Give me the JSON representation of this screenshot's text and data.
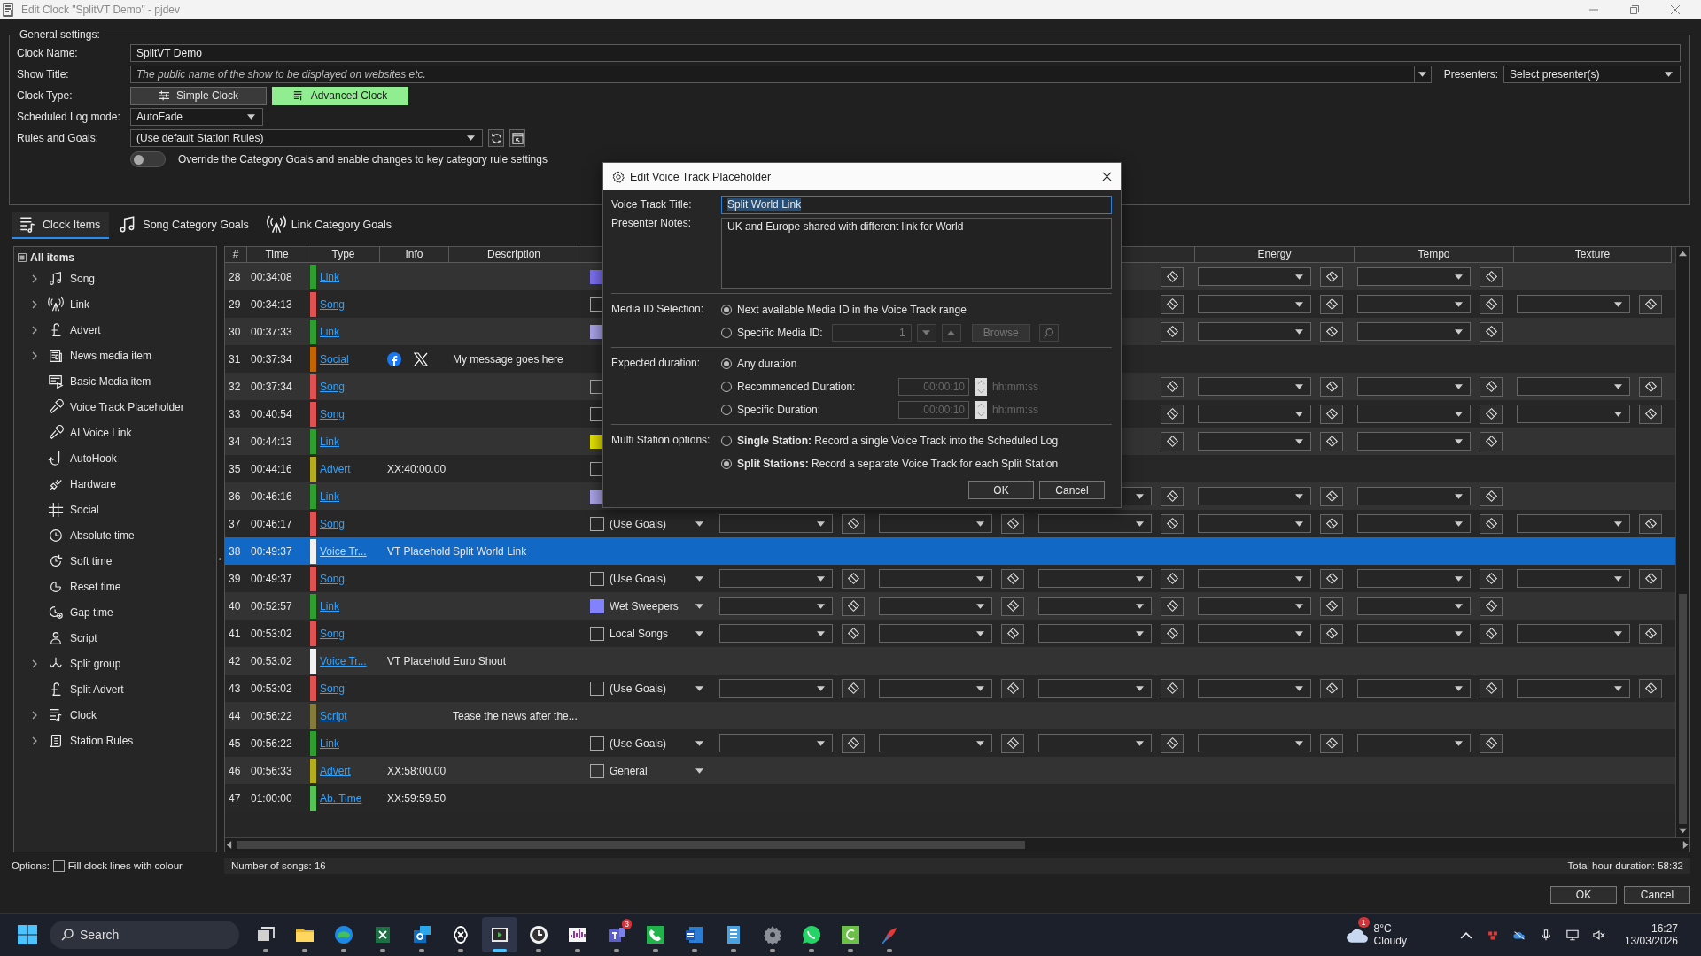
{
  "window": {
    "title": "Edit Clock \"SplitVT Demo\" - pjdev"
  },
  "general": {
    "legend": "General settings:",
    "clock_name": {
      "label": "Clock Name:",
      "value": "SplitVT Demo"
    },
    "show_title": {
      "label": "Show Title:",
      "placeholder": "The public name of the show to be displayed on websites etc."
    },
    "presenters": {
      "label": "Presenters:",
      "value": "Select presenter(s)"
    },
    "clock_type": {
      "label": "Clock Type:",
      "options": [
        {
          "label": "Simple Clock",
          "selected": false
        },
        {
          "label": "Advanced Clock",
          "selected": true
        }
      ]
    },
    "log_mode": {
      "label": "Scheduled Log mode:",
      "value": "AutoFade"
    },
    "rules": {
      "label": "Rules and Goals:",
      "value": "(Use default Station Rules)"
    },
    "override": {
      "label": "Override the Category Goals and enable changes to key category rule settings",
      "on": false
    }
  },
  "tabs": [
    {
      "label": "Clock Items",
      "selected": true
    },
    {
      "label": "Song Category Goals",
      "selected": false
    },
    {
      "label": "Link Category Goals",
      "selected": false
    }
  ],
  "sidebar": {
    "root": {
      "label": "All items"
    },
    "items": [
      {
        "label": "Song",
        "expandable": true
      },
      {
        "label": "Link",
        "expandable": true
      },
      {
        "label": "Advert",
        "expandable": true
      },
      {
        "label": "News media item",
        "expandable": true
      },
      {
        "label": "Basic Media item",
        "expandable": false
      },
      {
        "label": "Voice Track Placeholder",
        "expandable": false
      },
      {
        "label": "AI Voice Link",
        "expandable": false
      },
      {
        "label": "AutoHook",
        "expandable": false
      },
      {
        "label": "Hardware",
        "expandable": false
      },
      {
        "label": "Social",
        "expandable": false
      },
      {
        "label": "Absolute time",
        "expandable": false
      },
      {
        "label": "Soft time",
        "expandable": false
      },
      {
        "label": "Reset time",
        "expandable": false
      },
      {
        "label": "Gap time",
        "expandable": false
      },
      {
        "label": "Script",
        "expandable": false
      },
      {
        "label": "Split group",
        "expandable": true
      },
      {
        "label": "Split Advert",
        "expandable": false
      },
      {
        "label": "Clock",
        "expandable": true
      },
      {
        "label": "Station Rules",
        "expandable": true
      }
    ]
  },
  "table": {
    "columns": [
      "#",
      "Time",
      "Type",
      "Info",
      "Description"
    ],
    "goal_columns": [
      "Energy",
      "Tempo",
      "Texture"
    ],
    "rows": [
      {
        "num": "28",
        "time": "00:34:08",
        "type": "Link",
        "color": "#2e9e2e",
        "selected": false,
        "category": {
          "kind": "swatch",
          "color": "#7b6ff0"
        },
        "goal_fields": true,
        "texture": false
      },
      {
        "num": "29",
        "time": "00:34:13",
        "type": "Song",
        "color": "#e05252",
        "selected": false,
        "category": {
          "kind": "box"
        },
        "goal_fields": true,
        "texture": true
      },
      {
        "num": "30",
        "time": "00:37:33",
        "type": "Link",
        "color": "#2e9e2e",
        "selected": false,
        "category": {
          "kind": "swatch",
          "color": "#a9a2e6"
        },
        "goal_fields": true,
        "texture": false
      },
      {
        "num": "31",
        "time": "00:37:34",
        "type": "Social",
        "color": "#c46400",
        "selected": false,
        "icons": true,
        "description": "My message goes here"
      },
      {
        "num": "32",
        "time": "00:37:34",
        "type": "Song",
        "color": "#e05252",
        "selected": false,
        "category": {
          "kind": "box"
        },
        "goal_fields": true,
        "texture": true
      },
      {
        "num": "33",
        "time": "00:40:54",
        "type": "Song",
        "color": "#e05252",
        "selected": false,
        "category": {
          "kind": "box"
        },
        "goal_fields": true,
        "texture": true
      },
      {
        "num": "34",
        "time": "00:44:13",
        "type": "Link",
        "color": "#2e9e2e",
        "selected": false,
        "category": {
          "kind": "swatch",
          "color": "#e2e000"
        },
        "goal_fields": true,
        "texture": false
      },
      {
        "num": "35",
        "time": "00:44:16",
        "type": "Advert",
        "color": "#b4ac1c",
        "selected": false,
        "info": "XX:40:00.00",
        "category": {
          "kind": "box"
        },
        "goal_fields": false
      },
      {
        "num": "36",
        "time": "00:46:16",
        "type": "Link",
        "color": "#2e9e2e",
        "selected": false,
        "category": {
          "kind": "swatch",
          "color": "#a9a2e6"
        },
        "goal_fields": true,
        "texture": false
      },
      {
        "num": "37",
        "time": "00:46:17",
        "type": "Song",
        "color": "#e05252",
        "selected": false,
        "category": {
          "kind": "box",
          "label": "(Use Goals)"
        },
        "goal_fields": true,
        "texture": true
      },
      {
        "num": "38",
        "time": "00:49:37",
        "type": "Voice Tr...",
        "color": "#f2f2f2",
        "selected": true,
        "info": "VT Placehold",
        "description": "Split World Link"
      },
      {
        "num": "39",
        "time": "00:49:37",
        "type": "Song",
        "color": "#e05252",
        "selected": false,
        "category": {
          "kind": "box",
          "label": "(Use Goals)"
        },
        "goal_fields": true,
        "texture": true
      },
      {
        "num": "40",
        "time": "00:52:57",
        "type": "Link",
        "color": "#2e9e2e",
        "selected": false,
        "category": {
          "kind": "swatch",
          "color": "#8282ff",
          "label": "Wet Sweepers"
        },
        "goal_fields": true,
        "texture": false
      },
      {
        "num": "41",
        "time": "00:53:02",
        "type": "Song",
        "color": "#e05252",
        "selected": false,
        "category": {
          "kind": "box",
          "label": "Local Songs"
        },
        "goal_fields": true,
        "texture": true
      },
      {
        "num": "42",
        "time": "00:53:02",
        "type": "Voice Tr...",
        "color": "#f2f2f2",
        "selected": false,
        "info": "VT Placehold",
        "description": "Euro Shout"
      },
      {
        "num": "43",
        "time": "00:53:02",
        "type": "Song",
        "color": "#e05252",
        "selected": false,
        "category": {
          "kind": "box",
          "label": "(Use Goals)"
        },
        "goal_fields": true,
        "texture": true
      },
      {
        "num": "44",
        "time": "00:56:22",
        "type": "Script",
        "color": "#857c3c",
        "selected": false,
        "description": "Tease the news after the..."
      },
      {
        "num": "45",
        "time": "00:56:22",
        "type": "Link",
        "color": "#2e9e2e",
        "selected": false,
        "category": {
          "kind": "box",
          "label": "(Use Goals)"
        },
        "goal_fields": true,
        "texture": false
      },
      {
        "num": "46",
        "time": "00:56:33",
        "type": "Advert",
        "color": "#b4ac1c",
        "selected": false,
        "info": "XX:58:00.00",
        "category": {
          "kind": "box",
          "label": "General"
        },
        "goal_fields": false
      },
      {
        "num": "47",
        "time": "01:00:00",
        "type": "Ab. Time",
        "color": "#55c455",
        "selected": false,
        "info": "XX:59:59.50"
      }
    ]
  },
  "options": {
    "label": "Options:",
    "fill_lines": {
      "label": "Fill clock lines with colour",
      "checked": false
    }
  },
  "status": {
    "songs": "Number of songs: 16",
    "duration": "Total hour duration: 58:32"
  },
  "buttons": {
    "ok": "OK",
    "cancel": "Cancel"
  },
  "dialog": {
    "title": "Edit Voice Track Placeholder",
    "vt_title": {
      "label": "Voice Track Title:",
      "value": "Split World Link"
    },
    "notes": {
      "label": "Presenter Notes:",
      "value": "UK and Europe shared with different link for World"
    },
    "media_id": {
      "label": "Media ID Selection:",
      "options": [
        {
          "label": "Next available Media ID in the Voice Track range",
          "selected": true
        },
        {
          "label": "Specific Media ID:",
          "selected": false
        }
      ],
      "value": "1",
      "browse": "Browse"
    },
    "duration": {
      "label": "Expected duration:",
      "options": [
        {
          "label": "Any duration",
          "selected": true
        },
        {
          "label": "Recommended Duration:",
          "selected": false,
          "value": "00:00:10",
          "unit": "hh:mm:ss"
        },
        {
          "label": "Specific Duration:",
          "selected": false,
          "value": "00:00:10",
          "unit": "hh:mm:ss"
        }
      ]
    },
    "multi": {
      "label": "Multi Station options:",
      "options": [
        {
          "label": "**Single Station:** Record a single Voice Track into the Scheduled Log",
          "selected": false
        },
        {
          "label": "**Split Stations:** Record a separate Voice Track for each Split Station",
          "selected": true
        }
      ]
    },
    "ok": "OK",
    "cancel": "Cancel"
  },
  "taskbar": {
    "placeholder": "Search",
    "apps": [
      {
        "selected": false
      },
      {
        "selected": false
      },
      {
        "selected": false
      },
      {
        "selected": false
      },
      {
        "selected": false
      },
      {
        "selected": false
      },
      {
        "selected": true
      },
      {
        "selected": false
      },
      {
        "selected": false
      },
      {
        "selected": false,
        "badge": "3"
      },
      {
        "selected": false
      },
      {
        "selected": false
      },
      {
        "selected": false
      },
      {
        "selected": false
      },
      {
        "selected": false
      },
      {
        "selected": false
      },
      {
        "selected": false
      }
    ],
    "weather": {
      "temp": "8°C",
      "text": "Cloudy",
      "badge": "1"
    },
    "clock": {
      "time": "16:27",
      "date": "13/03/2026"
    }
  }
}
